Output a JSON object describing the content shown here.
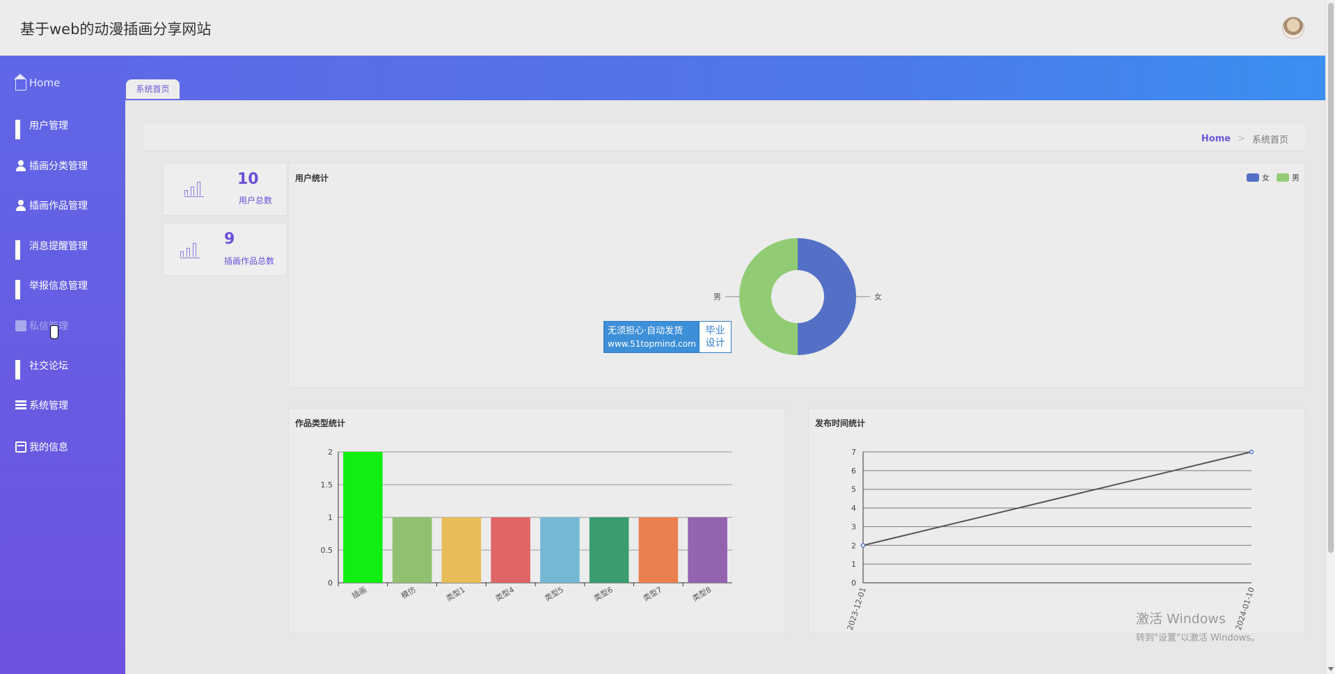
{
  "header": {
    "title": "基于web的动漫插画分享网站"
  },
  "sidebar": {
    "items": [
      {
        "label": "Home"
      },
      {
        "label": "用户管理"
      },
      {
        "label": "插画分类管理"
      },
      {
        "label": "插画作品管理"
      },
      {
        "label": "消息提醒管理"
      },
      {
        "label": "举报信息管理"
      },
      {
        "label": "私信管理"
      },
      {
        "label": "社交论坛"
      },
      {
        "label": "系统管理"
      },
      {
        "label": "我的信息"
      }
    ]
  },
  "tabs": [
    {
      "label": "系统首页"
    }
  ],
  "breadcrumb": {
    "home": "Home",
    "separator": ">",
    "current": "系统首页"
  },
  "stats": [
    {
      "value": "10",
      "label": "用户总数"
    },
    {
      "value": "9",
      "label": "插画作品总数"
    }
  ],
  "watermark": {
    "line1": "无须担心·自动发货",
    "line2": "www.51topmind.com",
    "side1": "毕业",
    "side2": "设计"
  },
  "windows_watermark": {
    "line1": "激活 Windows",
    "line2": "转到\"设置\"以激活 Windows。"
  },
  "colors": {
    "accent": "#6b4fd6",
    "female": "#5470c6",
    "male": "#91cc75"
  },
  "chart_data": [
    {
      "type": "pie",
      "title": "用户统计",
      "donut": true,
      "legend_position": "top-right",
      "labels": [
        "女",
        "男"
      ],
      "values": [
        5,
        5
      ]
    },
    {
      "type": "bar",
      "title": "作品类型统计",
      "categories": [
        "插画",
        "模仿",
        "类型1",
        "类型4",
        "类型5",
        "类型6",
        "类型7",
        "类型8"
      ],
      "values": [
        2,
        1,
        1,
        1,
        1,
        1,
        1,
        1
      ],
      "colors": [
        "#11ee11",
        "#91c070",
        "#e8bc58",
        "#e06666",
        "#73b8d4",
        "#3b9c6f",
        "#ea8050",
        "#9463ae"
      ],
      "ylim": [
        0,
        2
      ],
      "yticks": [
        "0",
        "0.5",
        "1",
        "1.5",
        "2"
      ],
      "grid": true
    },
    {
      "type": "line",
      "title": "发布时间统计",
      "x": [
        "2023-12-01",
        "2024-01-10"
      ],
      "values": [
        2,
        7
      ],
      "ylim": [
        0,
        7
      ],
      "yticks": [
        "0",
        "1",
        "2",
        "3",
        "4",
        "5",
        "6",
        "7"
      ],
      "grid": true
    }
  ]
}
